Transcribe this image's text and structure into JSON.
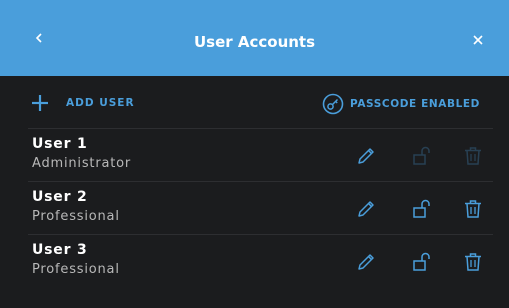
{
  "header": {
    "title": "User Accounts",
    "back_icon": "chevron-left-icon",
    "close_icon": "close-icon",
    "background": "#4a9edb"
  },
  "toolbar": {
    "add_label": "ADD USER",
    "passcode_label": "PASSCODE ENABLED",
    "accent": "#4a9edb"
  },
  "users": [
    {
      "name": "User 1",
      "role": "Administrator",
      "lock_enabled": false,
      "delete_enabled": false
    },
    {
      "name": "User 2",
      "role": "Professional",
      "lock_enabled": true,
      "delete_enabled": true
    },
    {
      "name": "User 3",
      "role": "Professional",
      "lock_enabled": true,
      "delete_enabled": true
    }
  ]
}
